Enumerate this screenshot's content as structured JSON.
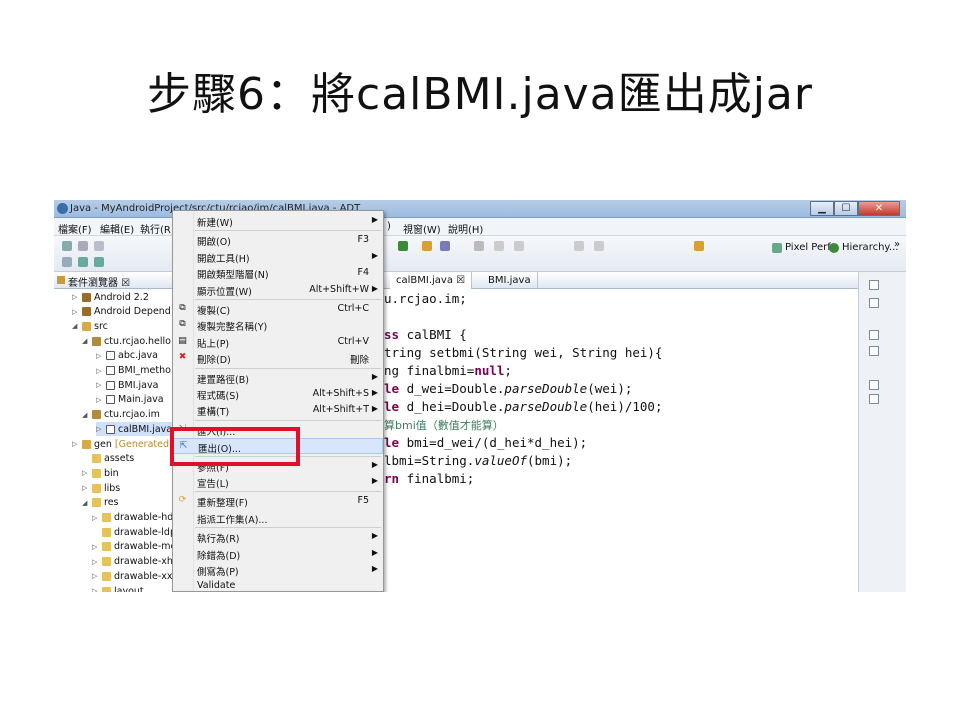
{
  "slide": {
    "title": "步驟6：將calBMI.java匯出成jar"
  },
  "window": {
    "title": "Java - MyAndroidProject/src/ctu/rcjao/im/calBMI.java - ADT",
    "min": "▁",
    "max": "☐",
    "close": "✕"
  },
  "menubar": {
    "file": "檔案(F)",
    "edit": "編輯(E)",
    "run": "執行(R)",
    "window": "視窗(W)",
    "help": "說明(H)",
    "fragment": ")"
  },
  "toolbar": {
    "pixel_perfect": "Pixel Perf...",
    "hierarchy": "Hierarchy...",
    "overflow": "»"
  },
  "explorer": {
    "tab_label": "套件瀏覽器 ☒",
    "rows": [
      {
        "tw": "▷",
        "label": "Android 2.2"
      },
      {
        "tw": "▷",
        "label": "Android Depend"
      },
      {
        "tw": "◢",
        "label": "src"
      },
      {
        "tw": "◢",
        "label": "ctu.rcjao.hello"
      },
      {
        "tw": "▷",
        "label": "abc.java"
      },
      {
        "tw": "▷",
        "label": "BMI_metho"
      },
      {
        "tw": "▷",
        "label": "BMI.java"
      },
      {
        "tw": "▷",
        "label": "Main.java"
      },
      {
        "tw": "◢",
        "label": "ctu.rcjao.im"
      },
      {
        "tw": "▷",
        "label": "calBMI.java"
      },
      {
        "tw": "▷",
        "label": "gen",
        "suffix": "[Generated"
      },
      {
        "tw": "",
        "label": "assets"
      },
      {
        "tw": "▷",
        "label": "bin"
      },
      {
        "tw": "▷",
        "label": "libs"
      },
      {
        "tw": "◢",
        "label": "res"
      },
      {
        "tw": "▷",
        "label": "drawable-hdp"
      },
      {
        "tw": "",
        "label": "drawable-ldp"
      },
      {
        "tw": "▷",
        "label": "drawable-mc"
      },
      {
        "tw": "▷",
        "label": "drawable-xhc"
      },
      {
        "tw": "▷",
        "label": "drawable-xxh"
      },
      {
        "tw": "▷",
        "label": "layout"
      }
    ]
  },
  "editor": {
    "tabs": [
      "calBMI.java ☒",
      "BMI.java"
    ],
    "lines": [
      {
        "parts": [
          {
            "t": "u.rcjao.im;"
          }
        ]
      },
      {
        "parts": [
          {
            "t": ""
          }
        ]
      },
      {
        "parts": [
          {
            "t": "ss",
            "c": "kw"
          },
          {
            "t": " calBMI {"
          }
        ]
      },
      {
        "parts": [
          {
            "t": "tring setbmi(String wei, String hei){"
          }
        ]
      },
      {
        "parts": [
          {
            "t": "ng finalbmi="
          },
          {
            "t": "null",
            "c": "kw"
          },
          {
            "t": ";"
          }
        ]
      },
      {
        "parts": [
          {
            "t": "le",
            "c": "kw"
          },
          {
            "t": " d_wei=Double."
          },
          {
            "t": "parseDouble",
            "c": "it"
          },
          {
            "t": "(wei);"
          }
        ]
      },
      {
        "parts": [
          {
            "t": "le",
            "c": "kw"
          },
          {
            "t": " d_hei=Double."
          },
          {
            "t": "parseDouble",
            "c": "it"
          },
          {
            "t": "(hei)/100;"
          }
        ]
      },
      {
        "parts": [
          {
            "t": "算bmi值（數值才能算）",
            "c": "cm"
          }
        ]
      },
      {
        "parts": [
          {
            "t": "le",
            "c": "kw"
          },
          {
            "t": " bmi=d_wei/(d_hei*d_hei);"
          }
        ]
      },
      {
        "parts": [
          {
            "t": "lbmi=String."
          },
          {
            "t": "valueOf",
            "c": "it"
          },
          {
            "t": "(bmi);"
          }
        ]
      },
      {
        "parts": [
          {
            "t": "rn",
            "c": "kw"
          },
          {
            "t": " finalbmi;"
          }
        ]
      }
    ]
  },
  "context_menu": {
    "items": [
      {
        "label": "新建(W)",
        "shortcut": "",
        "submenu": true
      },
      {
        "sep": true
      },
      {
        "label": "開啟(O)",
        "shortcut": "F3"
      },
      {
        "label": "開啟工具(H)",
        "shortcut": "",
        "submenu": true
      },
      {
        "label": "開啟類型階層(N)",
        "shortcut": "F4"
      },
      {
        "label": "顯示位置(W)",
        "shortcut": "Alt+Shift+W",
        "submenu": true
      },
      {
        "sep": true
      },
      {
        "label": "複製(C)",
        "shortcut": "Ctrl+C",
        "icon": "copy-icon"
      },
      {
        "label": "複製完整名稱(Y)",
        "shortcut": "",
        "icon": "copy-name-icon"
      },
      {
        "label": "貼上(P)",
        "shortcut": "Ctrl+V",
        "icon": "paste-icon"
      },
      {
        "label": "刪除(D)",
        "shortcut": "刪除",
        "icon": "delete-icon"
      },
      {
        "sep": true
      },
      {
        "label": "建置路徑(B)",
        "shortcut": "",
        "submenu": true
      },
      {
        "label": "程式碼(S)",
        "shortcut": "Alt+Shift+S",
        "submenu": true
      },
      {
        "label": "重構(T)",
        "shortcut": "Alt+Shift+T",
        "submenu": true
      },
      {
        "sep": true
      },
      {
        "label": "匯入(I)...",
        "shortcut": "",
        "icon": "import-icon"
      },
      {
        "label": "匯出(O)...",
        "shortcut": "",
        "icon": "export-icon",
        "highlighted": true
      },
      {
        "sep": true
      },
      {
        "label": "參照(F)",
        "shortcut": "",
        "submenu": true
      },
      {
        "label": "宣告(L)",
        "shortcut": "",
        "submenu": true
      },
      {
        "sep": true
      },
      {
        "label": "重新整理(F)",
        "shortcut": "F5",
        "icon": "refresh-icon"
      },
      {
        "label": "指派工作集(A)...",
        "shortcut": ""
      },
      {
        "sep": true
      },
      {
        "label": "執行為(R)",
        "shortcut": "",
        "submenu": true
      },
      {
        "label": "除錯為(D)",
        "shortcut": "",
        "submenu": true
      },
      {
        "label": "側寫為(P)",
        "shortcut": "",
        "submenu": true
      },
      {
        "label": "Validate",
        "shortcut": ""
      }
    ]
  },
  "colors": {
    "highlight_box": "#e0102a",
    "keyword": "#7f0055",
    "comment": "#3f7f5f"
  }
}
